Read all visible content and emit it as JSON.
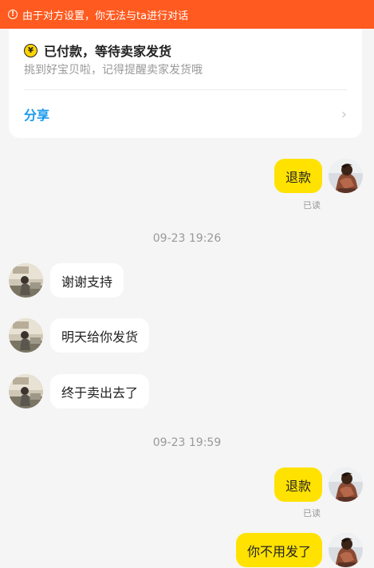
{
  "banner": {
    "icon": "warning-circle-icon",
    "text": "由于对方设置，你无法与ta进行对话"
  },
  "order": {
    "icon": "yen-coin-icon",
    "icon_glyph": "¥",
    "title": "已付款，等待卖家发货",
    "subtitle": "挑到好宝贝啦，记得提醒卖家发货哦",
    "share_label": "分享",
    "chevron": "›"
  },
  "colors": {
    "banner": "#ff5a1f",
    "my_bubble": "#ffe200",
    "link": "#1a9af0"
  },
  "messages": [
    {
      "text": "退款",
      "read": "已读"
    },
    {
      "time": "09-23 19:26"
    },
    {
      "text": "谢谢支持"
    },
    {
      "text": "明天给你发货"
    },
    {
      "text": "终于卖出去了"
    },
    {
      "time": "09-23 19:59"
    },
    {
      "text": "退款",
      "read": "已读"
    },
    {
      "text": "你不用发了"
    }
  ]
}
